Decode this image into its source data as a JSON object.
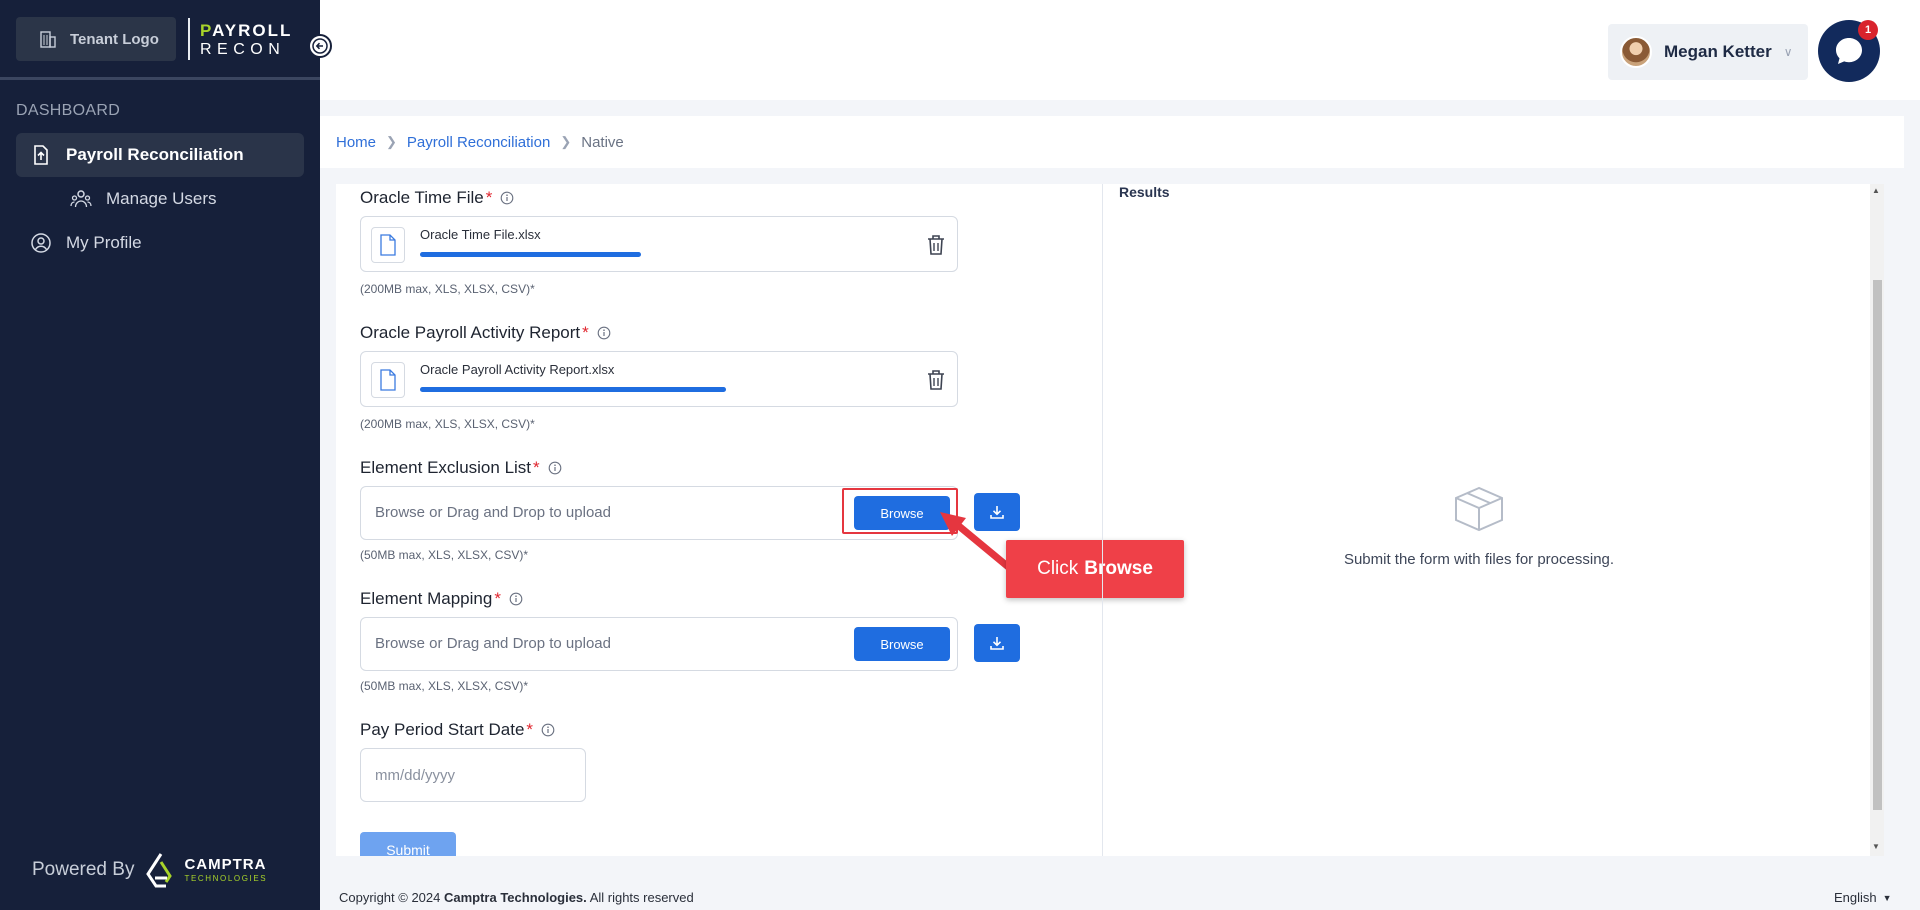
{
  "sidebar": {
    "tenant_logo": "Tenant Logo",
    "brand_top": "PAYROLL",
    "brand_top_first": "P",
    "brand_top_rest": "AYROLL",
    "brand_bottom": "RECON",
    "section": "DASHBOARD",
    "items": [
      {
        "label": "Payroll Reconciliation",
        "icon": "upload-file-icon",
        "active": true
      },
      {
        "label": "Manage Users",
        "icon": "users-icon"
      },
      {
        "label": "My Profile",
        "icon": "user-circle-icon"
      }
    ],
    "powered_by": "Powered By",
    "camptra_name": "CAMPTRA",
    "camptra_sub": "TECHNOLOGIES"
  },
  "header": {
    "user_name": "Megan Ketter",
    "chat_badge": "1"
  },
  "breadcrumb": {
    "home": "Home",
    "section": "Payroll Reconciliation",
    "current": "Native"
  },
  "form": {
    "time_file": {
      "label": "Oracle Time File",
      "required": "*",
      "file_name": "Oracle Time File.xlsx",
      "progress": 0.49,
      "hint": "(200MB max, XLS, XLSX, CSV)*"
    },
    "activity_report": {
      "label": "Oracle Payroll Activity Report",
      "required": "*",
      "file_name": "Oracle Payroll Activity Report.xlsx",
      "progress": 0.68,
      "hint": "(200MB max, XLS, XLSX, CSV)*"
    },
    "exclusion_list": {
      "label": "Element Exclusion List",
      "required": "*",
      "placeholder": "Browse or Drag and Drop to upload",
      "browse": "Browse",
      "hint": "(50MB max, XLS, XLSX, CSV)*"
    },
    "element_mapping": {
      "label": "Element Mapping",
      "required": "*",
      "placeholder": "Browse or Drag and Drop to upload",
      "browse": "Browse",
      "hint": "(50MB max, XLS, XLSX, CSV)*"
    },
    "start_date": {
      "label": "Pay Period Start Date",
      "required": "*",
      "placeholder": "mm/dd/yyyy"
    },
    "submit": "Submit"
  },
  "results": {
    "title": "Results",
    "empty_message": "Submit the form with files for processing."
  },
  "callout": {
    "prefix": "Click",
    "target": "Browse"
  },
  "footer": {
    "copyright": "Copyright © 2024",
    "company": "Camptra Technologies.",
    "rights": "All rights reserved",
    "language": "English"
  },
  "colors": {
    "sidebar_bg": "#16203a",
    "accent_blue": "#1f6de0",
    "brand_green": "#a8d32a",
    "required_red": "#e0252e",
    "callout_red": "#ef4048"
  }
}
